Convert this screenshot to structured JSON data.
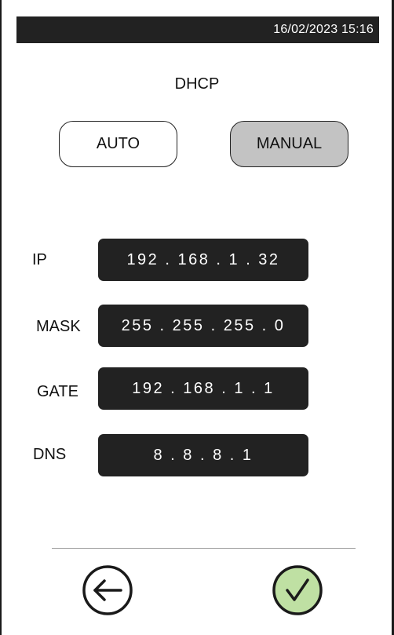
{
  "status_bar": {
    "datetime": "16/02/2023 15:16"
  },
  "page": {
    "title": "DHCP"
  },
  "mode": {
    "options": [
      "AUTO",
      "MANUAL"
    ],
    "selected": "MANUAL"
  },
  "network": {
    "ip": {
      "label": "IP",
      "value": "192.168.1.32"
    },
    "mask": {
      "label": "MASK",
      "value": "255.255.255.0"
    },
    "gate": {
      "label": "GATE",
      "value": "192.168.1.1"
    },
    "dns": {
      "label": "DNS",
      "value": "8.8.8.1"
    }
  },
  "footer": {
    "back_icon": "arrow-left-circle-icon",
    "confirm_icon": "check-circle-icon"
  },
  "colors": {
    "dark": "#222222",
    "selected_mode": "#c3c3c3",
    "confirm_fill": "#bfe0a3"
  }
}
